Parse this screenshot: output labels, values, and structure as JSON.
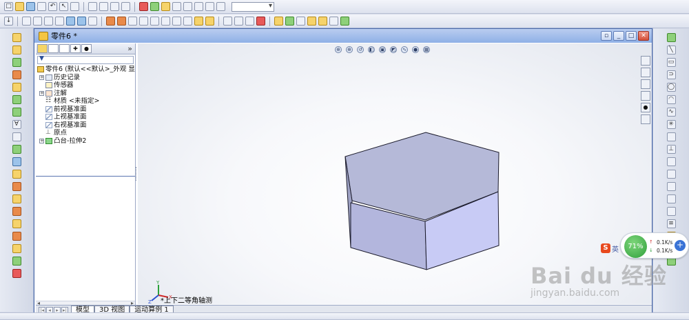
{
  "document": {
    "title": "零件6 *"
  },
  "feature_manager": {
    "tree": [
      {
        "label": "零件6  (默认<<默认>_外观 显",
        "icon": "part-icon"
      },
      {
        "label": "历史记录",
        "icon": "history-icon",
        "expandable": true
      },
      {
        "label": "传感器",
        "icon": "sensor-icon",
        "expandable": false
      },
      {
        "label": "注解",
        "icon": "annotation-icon",
        "expandable": true
      },
      {
        "label": "材质 <未指定>",
        "icon": "material-icon",
        "expandable": false
      },
      {
        "label": "前视基准面",
        "icon": "plane-icon",
        "expandable": false
      },
      {
        "label": "上视基准面",
        "icon": "plane-icon",
        "expandable": false
      },
      {
        "label": "右视基准面",
        "icon": "plane-icon",
        "expandable": false
      },
      {
        "label": "原点",
        "icon": "origin-icon",
        "expandable": false
      },
      {
        "label": "凸台-拉伸2",
        "icon": "boss-extrude-icon",
        "expandable": true
      }
    ],
    "more_label": "»"
  },
  "graphics": {
    "view_name": "*上下二等角轴测"
  },
  "bottom_tabs": [
    {
      "label": "模型",
      "active": true
    },
    {
      "label": "3D 视图",
      "active": false
    },
    {
      "label": "运动算例 1",
      "active": false
    }
  ],
  "overlay": {
    "percent": "71%",
    "up_speed": "0.1K/s",
    "down_speed": "0.1K/s",
    "plus": "+",
    "ime_icon": "S",
    "ime_label": "英"
  },
  "watermark": {
    "main": "Bai du 经验",
    "sub": "jingyan.baidu.com"
  },
  "colors": {
    "hex_top": "#b5b9d8",
    "hex_front": "#b3b6dd",
    "hex_right": "#c8cbf5",
    "hex_edge": "#1a1a2a"
  }
}
